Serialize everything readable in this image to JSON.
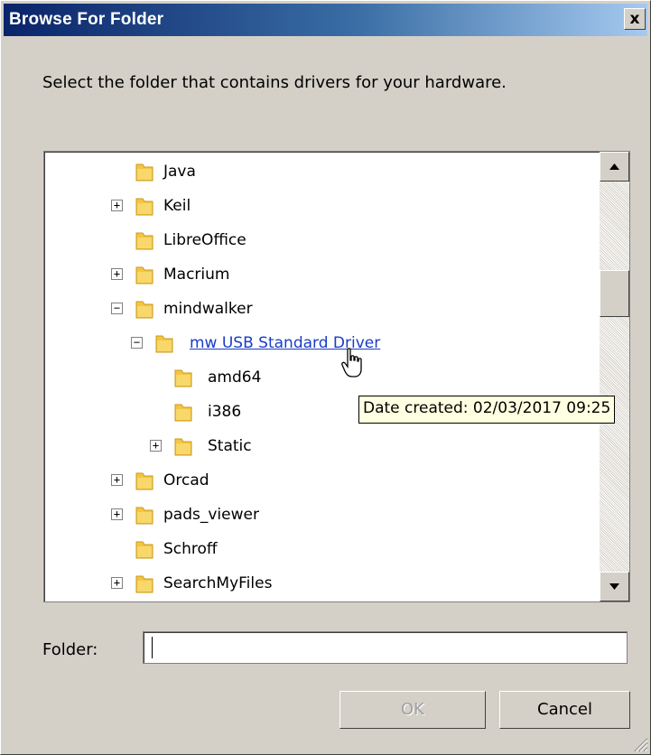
{
  "window": {
    "title": "Browse For Folder",
    "close_label": "x"
  },
  "instructions": "Select the folder that contains drivers for your hardware.",
  "tree": {
    "items": [
      {
        "label": "Java",
        "expander": "",
        "selected_link": false
      },
      {
        "label": "Keil",
        "expander": "+",
        "selected_link": false
      },
      {
        "label": "LibreOffice",
        "expander": "",
        "selected_link": false
      },
      {
        "label": "Macrium",
        "expander": "+",
        "selected_link": false
      },
      {
        "label": "mindwalker",
        "expander": "−",
        "selected_link": false
      },
      {
        "label": "mw USB Standard Driver",
        "expander": "−",
        "selected_link": true
      },
      {
        "label": "amd64",
        "expander": "",
        "selected_link": false
      },
      {
        "label": "i386",
        "expander": "",
        "selected_link": false
      },
      {
        "label": "Static",
        "expander": "+",
        "selected_link": false
      },
      {
        "label": "Orcad",
        "expander": "+",
        "selected_link": false
      },
      {
        "label": "pads_viewer",
        "expander": "+",
        "selected_link": false
      },
      {
        "label": "Schroff",
        "expander": "",
        "selected_link": false
      },
      {
        "label": "SearchMyFiles",
        "expander": "+",
        "selected_link": false
      }
    ]
  },
  "tooltip": "Date created: 02/03/2017 09:25",
  "folder_field": {
    "label": "Folder:",
    "value": ""
  },
  "buttons": {
    "ok": "OK",
    "cancel": "Cancel"
  },
  "colors": {
    "title_bar_start": "#0a246a",
    "title_bar_end": "#a6caf0",
    "dialog_bg": "#d4d0c8",
    "link": "#1a3cc8",
    "tooltip_bg": "#ffffe1",
    "folder_yellow": "#f4c542"
  }
}
